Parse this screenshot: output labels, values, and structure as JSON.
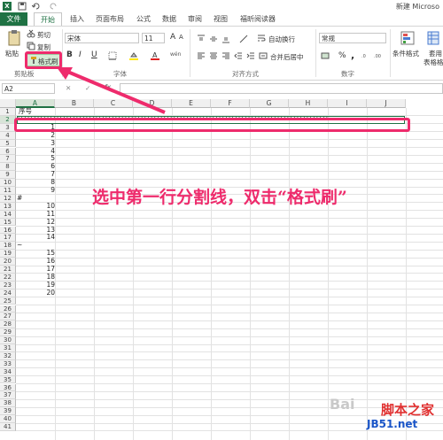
{
  "window": {
    "title": "新建 Microso"
  },
  "tabs": [
    "文件",
    "开始",
    "插入",
    "页面布局",
    "公式",
    "数据",
    "审阅",
    "视图",
    "福昕阅读器"
  ],
  "clipboard": {
    "paste": "粘贴",
    "cut": "剪切",
    "copy": "复制",
    "format_painter": "格式刷",
    "group": "剪贴板"
  },
  "font": {
    "name": "宋体",
    "size": "11",
    "bold": "B",
    "italic": "I",
    "underline": "U",
    "group": "字体",
    "wen": "wén",
    "grow": "A",
    "shrink": "A"
  },
  "alignment": {
    "wrap": "自动换行",
    "merge": "合并后居中",
    "group": "对齐方式"
  },
  "number": {
    "format": "常规",
    "percent": "%",
    "comma": ",",
    "group": "数字"
  },
  "styles": {
    "conditional": "条件格式",
    "table_format_a": "套用",
    "table_format_b": "表格格"
  },
  "formula_bar": {
    "name_box": "A2",
    "fx": "fx"
  },
  "columns": [
    "A",
    "B",
    "C",
    "D",
    "E",
    "F",
    "G",
    "H",
    "I",
    "J"
  ],
  "cell_a1": "序号",
  "separator_row": "''''''''''''''''''''''''''''''''''''''''''''''''''''''''''''''''''''''''''''''''''''''''''''''''",
  "rows_a": [
    "",
    "",
    "1",
    "2",
    "3",
    "4",
    "5",
    "6",
    "7",
    "8",
    "9",
    "#",
    "10",
    "11",
    "12",
    "13",
    "14",
    "~",
    "15",
    "16",
    "17",
    "18",
    "19",
    "20",
    "",
    "",
    "",
    "",
    "",
    "",
    "",
    "",
    "",
    "",
    "",
    "",
    "",
    "",
    "",
    "",
    "",
    ""
  ],
  "row_numbers": [
    "1",
    "2",
    "3",
    "4",
    "5",
    "6",
    "7",
    "8",
    "9",
    "10",
    "11",
    "12",
    "13",
    "14",
    "15",
    "16",
    "17",
    "18",
    "19",
    "20",
    "21",
    "22",
    "23",
    "24",
    "25",
    "26",
    "27",
    "28",
    "29",
    "30",
    "31",
    "32",
    "33",
    "34",
    "35",
    "36",
    "37",
    "38",
    "39",
    "40",
    "41"
  ],
  "annotation": "选中第一行分割线，双击“格式刷”",
  "watermark": {
    "left": "Bai",
    "right": "脚本之家",
    "url": "JB51.net"
  },
  "colors": {
    "excel_green": "#1f7244",
    "annotation": "#ee2b6c"
  }
}
